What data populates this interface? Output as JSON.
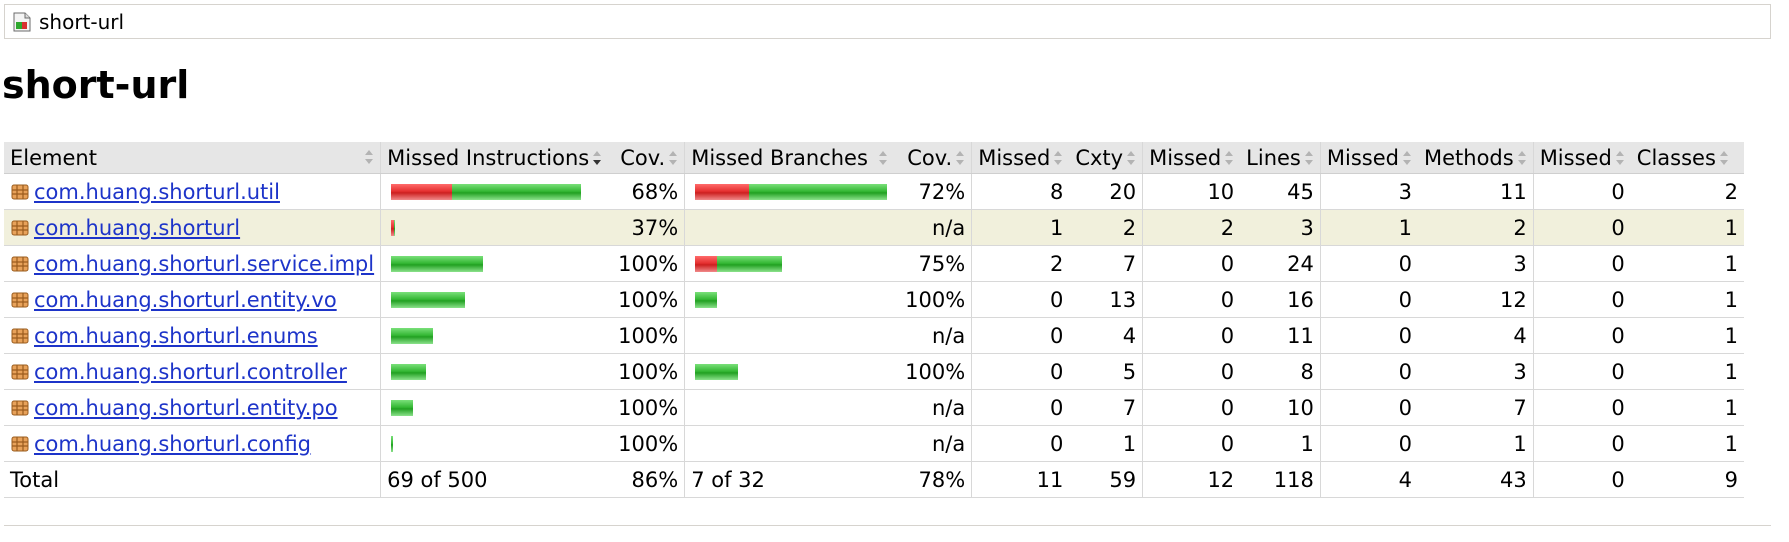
{
  "breadcrumb": {
    "label": "short-url"
  },
  "page_title": "short-url",
  "columns": {
    "element": "Element",
    "missed_instructions": "Missed Instructions",
    "cov_instructions": "Cov.",
    "missed_branches": "Missed Branches",
    "cov_branches": "Cov.",
    "missed_cxty": "Missed",
    "cxty": "Cxty",
    "missed_lines": "Missed",
    "lines": "Lines",
    "missed_methods": "Missed",
    "methods": "Methods",
    "missed_classes": "Missed",
    "classes": "Classes"
  },
  "max_bar_total": 186,
  "colors": {
    "covered": "#35b835",
    "missed": "#e53030",
    "highlight_row": "#f1f0dc",
    "link": "#1d34c9"
  },
  "rows": [
    {
      "name": "com.huang.shorturl.util",
      "instr_missed_frac": 0.32,
      "instr_total": 186,
      "cov_instr": "68%",
      "br_missed_frac": 0.28,
      "br_total": 188,
      "cov_br": "72%",
      "missed_cxty": "8",
      "cxty": "20",
      "missed_lines": "10",
      "lines": "45",
      "missed_methods": "3",
      "methods": "11",
      "missed_classes": "0",
      "classes": "2"
    },
    {
      "name": "com.huang.shorturl",
      "instr_missed_frac": 0.63,
      "instr_total": 4,
      "cov_instr": "37%",
      "br_missed_frac": 0,
      "br_total": 0,
      "cov_br": "n/a",
      "missed_cxty": "1",
      "cxty": "2",
      "missed_lines": "2",
      "lines": "3",
      "missed_methods": "1",
      "methods": "2",
      "missed_classes": "0",
      "classes": "1",
      "highlight": true
    },
    {
      "name": "com.huang.shorturl.service.impl",
      "instr_missed_frac": 0,
      "instr_total": 90,
      "cov_instr": "100%",
      "br_missed_frac": 0.25,
      "br_total": 85,
      "cov_br": "75%",
      "missed_cxty": "2",
      "cxty": "7",
      "missed_lines": "0",
      "lines": "24",
      "missed_methods": "0",
      "methods": "3",
      "missed_classes": "0",
      "classes": "1"
    },
    {
      "name": "com.huang.shorturl.entity.vo",
      "instr_missed_frac": 0,
      "instr_total": 72,
      "cov_instr": "100%",
      "br_missed_frac": 0,
      "br_total": 22,
      "cov_br": "100%",
      "missed_cxty": "0",
      "cxty": "13",
      "missed_lines": "0",
      "lines": "16",
      "missed_methods": "0",
      "methods": "12",
      "missed_classes": "0",
      "classes": "1"
    },
    {
      "name": "com.huang.shorturl.enums",
      "instr_missed_frac": 0,
      "instr_total": 41,
      "cov_instr": "100%",
      "br_missed_frac": 0,
      "br_total": 0,
      "cov_br": "n/a",
      "missed_cxty": "0",
      "cxty": "4",
      "missed_lines": "0",
      "lines": "11",
      "missed_methods": "0",
      "methods": "4",
      "missed_classes": "0",
      "classes": "1"
    },
    {
      "name": "com.huang.shorturl.controller",
      "instr_missed_frac": 0,
      "instr_total": 34,
      "cov_instr": "100%",
      "br_missed_frac": 0,
      "br_total": 42,
      "cov_br": "100%",
      "missed_cxty": "0",
      "cxty": "5",
      "missed_lines": "0",
      "lines": "8",
      "missed_methods": "0",
      "methods": "3",
      "missed_classes": "0",
      "classes": "1"
    },
    {
      "name": "com.huang.shorturl.entity.po",
      "instr_missed_frac": 0,
      "instr_total": 22,
      "cov_instr": "100%",
      "br_missed_frac": 0,
      "br_total": 0,
      "cov_br": "n/a",
      "missed_cxty": "0",
      "cxty": "7",
      "missed_lines": "0",
      "lines": "10",
      "missed_methods": "0",
      "methods": "7",
      "missed_classes": "0",
      "classes": "1"
    },
    {
      "name": "com.huang.shorturl.config",
      "instr_missed_frac": 0,
      "instr_total": 2,
      "cov_instr": "100%",
      "br_missed_frac": 0,
      "br_total": 0,
      "cov_br": "n/a",
      "missed_cxty": "0",
      "cxty": "1",
      "missed_lines": "0",
      "lines": "1",
      "missed_methods": "0",
      "methods": "1",
      "missed_classes": "0",
      "classes": "1"
    }
  ],
  "total": {
    "label": "Total",
    "instructions": "69 of 500",
    "cov_instr": "86%",
    "branches": "7 of 32",
    "cov_br": "78%",
    "missed_cxty": "11",
    "cxty": "59",
    "missed_lines": "12",
    "lines": "118",
    "missed_methods": "4",
    "methods": "43",
    "missed_classes": "0",
    "classes": "9"
  }
}
